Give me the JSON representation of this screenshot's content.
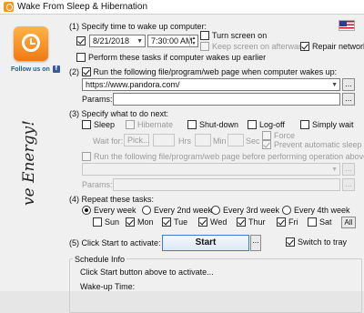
{
  "window": {
    "title": "Wake From Sleep & Hibernation"
  },
  "sidebar": {
    "follow_text": "Follow us on",
    "fb_glyph": "f",
    "slogan": "ve Energy!"
  },
  "step1": {
    "label": "(1) Specify time to wake up computer:",
    "date": "8/21/2018",
    "time": "7:30:00 AM",
    "turn_screen_on": "Turn screen on",
    "keep_screen_on": "Keep screen on afterwards",
    "repair_network": "Repair network",
    "perform_earlier": "Perform these tasks if computer wakes up earlier"
  },
  "step2": {
    "run_label": "Run the following file/program/web page when computer wakes up:",
    "url": "https://www.pandora.com/",
    "params_label": "Params:",
    "params_value": ""
  },
  "step3": {
    "label": "(3) Specify what to do next:",
    "options": [
      "Sleep",
      "Hibernate",
      "Shut-down",
      "Log-off",
      "Simply wait"
    ],
    "wait_for_label": "Wait for:",
    "pick_label": "Pick...",
    "hrs": "Hrs",
    "min": "Min",
    "sec": "Sec",
    "force": "Force",
    "prevent_sleep": "Prevent automatic sleep",
    "run_before": "Run the following file/program/web page before performing operation above:",
    "params_label": "Params:"
  },
  "step4": {
    "label": "(4) Repeat these tasks:",
    "repeat": [
      "Every week",
      "Every 2nd week",
      "Every 3rd week",
      "Every 4th week"
    ],
    "days": [
      "Sun",
      "Mon",
      "Tue",
      "Wed",
      "Thur",
      "Fri",
      "Sat"
    ],
    "all_label": "All"
  },
  "step5": {
    "label": "(5) Click Start to activate:",
    "start_label": "Start",
    "ellipsis": "...",
    "switch_tray": "Switch to tray"
  },
  "schedule": {
    "title": "Schedule Info",
    "hint": "Click Start button above to activate...",
    "wakeup_label": "Wake-up Time:"
  },
  "icons": {
    "calendar": "calendar-icon",
    "facebook": "facebook-icon",
    "flag": "us-flag-icon",
    "app": "app-clock-icon"
  }
}
